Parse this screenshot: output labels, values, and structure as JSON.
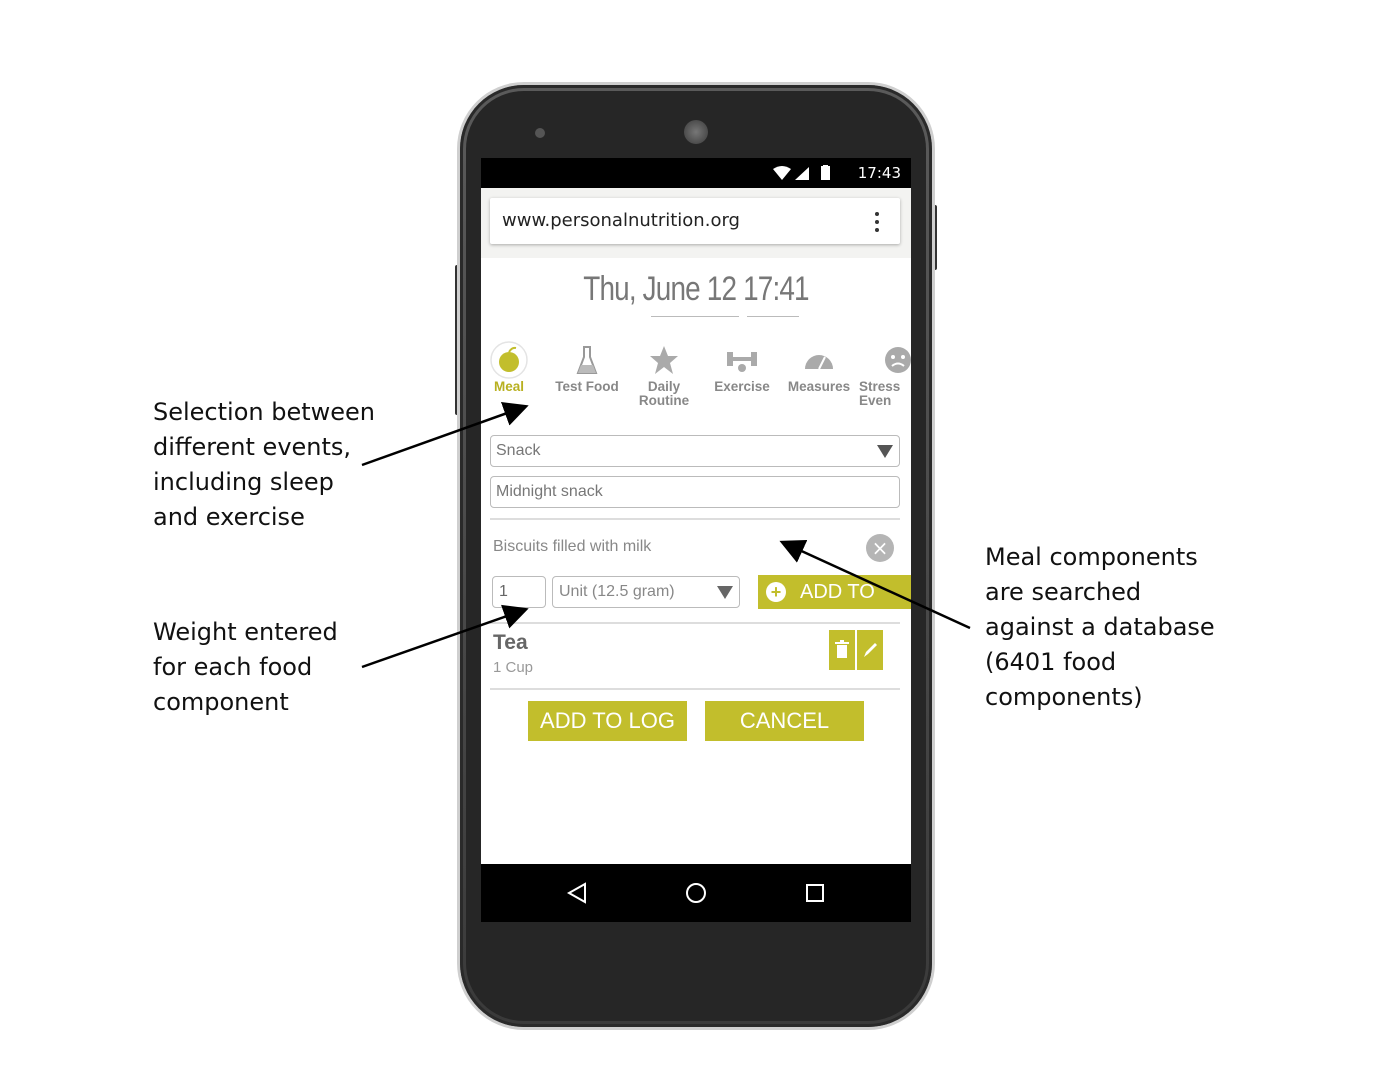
{
  "annotations": {
    "events": "Selection between\ndifferent events,\nincluding sleep\nand exercise",
    "weight": "Weight entered\nfor each food\ncomponent",
    "search": "Meal components\nare searched\nagainst a database\n(6401 food\ncomponents)"
  },
  "status_bar": {
    "time": "17:43"
  },
  "browser": {
    "url": "www.personalnutrition.org"
  },
  "page": {
    "datetime": "Thu, June 12 17:41",
    "events": [
      {
        "label": "Meal",
        "icon": "apple-icon",
        "active": true
      },
      {
        "label": "Test Food",
        "icon": "test-tube-icon"
      },
      {
        "label": "Daily Routine",
        "icon": "star-icon"
      },
      {
        "label": "Exercise",
        "icon": "dumbbell-icon"
      },
      {
        "label": "Measures",
        "icon": "gauge-icon"
      },
      {
        "label": "Stress Even",
        "icon": "stress-face-icon"
      }
    ],
    "meal_type": "Snack",
    "meal_name": "Midnight snack",
    "search_query": "Biscuits filled with milk",
    "quantity": "1",
    "unit": "Unit (12.5 gram)",
    "add_to_meal": "ADD TO MEAL",
    "component": {
      "name": "Tea",
      "amount": "1 Cup"
    },
    "add_to_log": "ADD TO LOG",
    "cancel": "CANCEL"
  },
  "colors": {
    "accent": "#c2be2c",
    "accent_text": "#b8b020"
  }
}
